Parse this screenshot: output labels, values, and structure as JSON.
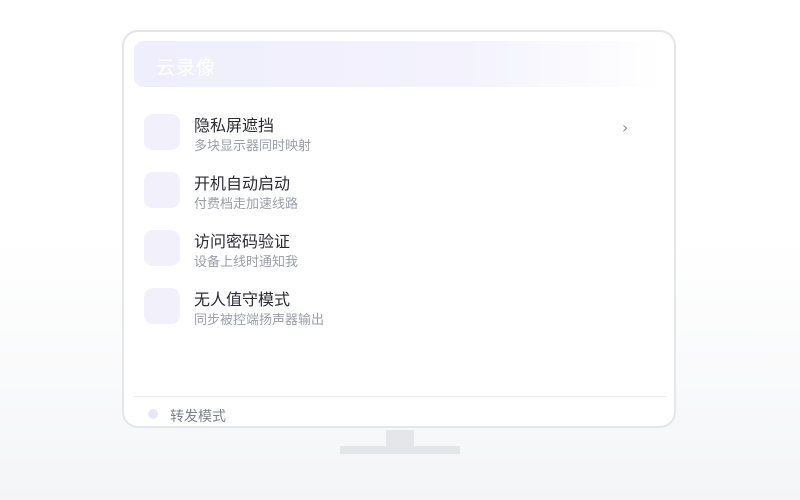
{
  "header": {
    "title": "云录像"
  },
  "items": [
    {
      "title": "隐私屏遮挡",
      "subtitle": "多块显示器同时映射",
      "chevron": "›"
    },
    {
      "title": "开机自动启动",
      "subtitle": "付费档走加速线路"
    },
    {
      "title": "访问密码验证",
      "subtitle": "设备上线时通知我"
    },
    {
      "title": "无人值守模式",
      "subtitle": "同步被控端扬声器输出"
    }
  ],
  "footer": {
    "label": "转发模式"
  },
  "colors": {
    "accent_light": "#efeefc",
    "frame": "#e4e6ea"
  }
}
